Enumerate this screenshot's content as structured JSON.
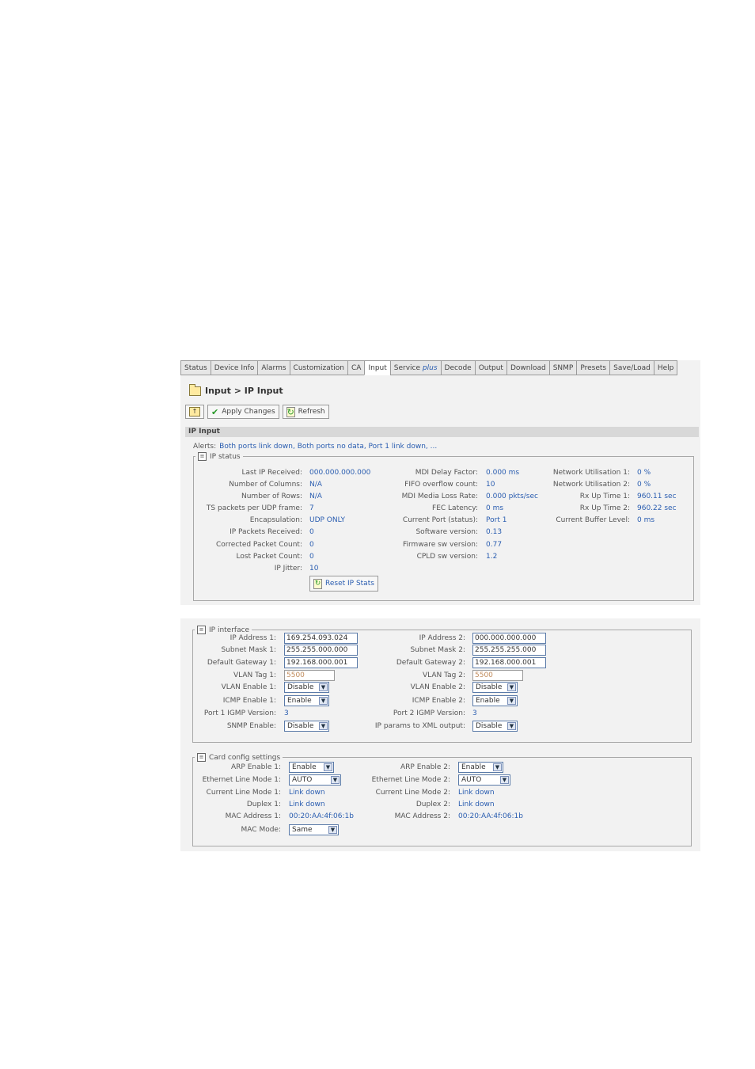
{
  "tabs": [
    {
      "label": "Status"
    },
    {
      "label": "Device Info"
    },
    {
      "label": "Alarms"
    },
    {
      "label": "Customization"
    },
    {
      "label": "CA"
    },
    {
      "label": "Input"
    },
    {
      "label": "Service"
    },
    {
      "label": "Decode"
    },
    {
      "label": "Output"
    },
    {
      "label": "Download"
    },
    {
      "label": "SNMP"
    },
    {
      "label": "Presets"
    },
    {
      "label": "Save/Load"
    },
    {
      "label": "Help"
    }
  ],
  "tab_service_plus": "plus",
  "breadcrumb": "Input > IP Input",
  "toolbar": {
    "apply": "Apply Changes",
    "refresh": "Refresh"
  },
  "section_title": "IP Input",
  "alerts": {
    "label": "Alerts:",
    "value": "Both ports link down, Both ports no data, Port 1 link down, ..."
  },
  "ip_status": {
    "legend": "IP status",
    "col1": [
      {
        "label": "Last IP Received:",
        "value": "000.000.000.000"
      },
      {
        "label": "Number of Columns:",
        "value": "N/A"
      },
      {
        "label": "Number of Rows:",
        "value": "N/A"
      },
      {
        "label": "TS packets per UDP frame:",
        "value": "7"
      },
      {
        "label": "Encapsulation:",
        "value": "UDP ONLY"
      },
      {
        "label": "IP Packets Received:",
        "value": "0"
      },
      {
        "label": "Corrected Packet Count:",
        "value": "0"
      },
      {
        "label": "Lost Packet Count:",
        "value": "0"
      },
      {
        "label": "IP Jitter:",
        "value": "10"
      }
    ],
    "col2": [
      {
        "label": "MDI Delay Factor:",
        "value": "0.000 ms"
      },
      {
        "label": "FIFO overflow count:",
        "value": "10"
      },
      {
        "label": "MDI Media Loss Rate:",
        "value": "0.000 pkts/sec"
      },
      {
        "label": "FEC Latency:",
        "value": "0 ms"
      },
      {
        "label": "Current Port (status):",
        "value": "Port 1"
      },
      {
        "label": "Software version:",
        "value": "0.13"
      },
      {
        "label": "Firmware sw version:",
        "value": "0.77"
      },
      {
        "label": "CPLD sw version:",
        "value": "1.2"
      }
    ],
    "col3": [
      {
        "label": "Network Utilisation 1:",
        "value": "0 %"
      },
      {
        "label": "Network Utilisation 2:",
        "value": "0 %"
      },
      {
        "label": "Rx Up Time 1:",
        "value": "960.11 sec"
      },
      {
        "label": "Rx Up Time 2:",
        "value": "960.22 sec"
      },
      {
        "label": "Current Buffer Level:",
        "value": "0 ms"
      }
    ],
    "reset_button": "Reset IP Stats"
  },
  "ip_interface": {
    "legend": "IP interface",
    "ip1": {
      "label": "IP Address 1:",
      "value": "169.254.093.024"
    },
    "mask1": {
      "label": "Subnet Mask 1:",
      "value": "255.255.000.000"
    },
    "gw1": {
      "label": "Default Gateway 1:",
      "value": "192.168.000.001"
    },
    "vlan1": {
      "label": "VLAN Tag 1:",
      "value": "5500"
    },
    "vlan_en1": {
      "label": "VLAN Enable 1:",
      "value": "Disable"
    },
    "icmp1": {
      "label": "ICMP Enable 1:",
      "value": "Enable"
    },
    "igmp1": {
      "label": "Port 1 IGMP Version:",
      "value": "3"
    },
    "snmp": {
      "label": "SNMP Enable:",
      "value": "Disable"
    },
    "ip2": {
      "label": "IP Address 2:",
      "value": "000.000.000.000"
    },
    "mask2": {
      "label": "Subnet Mask 2:",
      "value": "255.255.255.000"
    },
    "gw2": {
      "label": "Default Gateway 2:",
      "value": "192.168.000.001"
    },
    "vlan2": {
      "label": "VLAN Tag 2:",
      "value": "5500"
    },
    "vlan_en2": {
      "label": "VLAN Enable 2:",
      "value": "Disable"
    },
    "icmp2": {
      "label": "ICMP Enable 2:",
      "value": "Enable"
    },
    "igmp2": {
      "label": "Port 2 IGMP Version:",
      "value": "3"
    },
    "xml": {
      "label": "IP params to XML output:",
      "value": "Disable"
    }
  },
  "card_config": {
    "legend": "Card config settings",
    "arp1": {
      "label": "ARP Enable 1:",
      "value": "Enable"
    },
    "eth1": {
      "label": "Ethernet Line Mode 1:",
      "value": "AUTO"
    },
    "cur1": {
      "label": "Current Line Mode 1:",
      "value": "Link down"
    },
    "dup1": {
      "label": "Duplex 1:",
      "value": "Link down"
    },
    "mac1": {
      "label": "MAC Address 1:",
      "value": "00:20:AA:4f:06:1b"
    },
    "macmode": {
      "label": "MAC Mode:",
      "value": "Same"
    },
    "arp2": {
      "label": "ARP Enable 2:",
      "value": "Enable"
    },
    "eth2": {
      "label": "Ethernet Line Mode 2:",
      "value": "AUTO"
    },
    "cur2": {
      "label": "Current Line Mode 2:",
      "value": "Link down"
    },
    "dup2": {
      "label": "Duplex 2:",
      "value": "Link down"
    },
    "mac2": {
      "label": "MAC Address 2:",
      "value": "00:20:AA:4f:06:1b"
    }
  }
}
